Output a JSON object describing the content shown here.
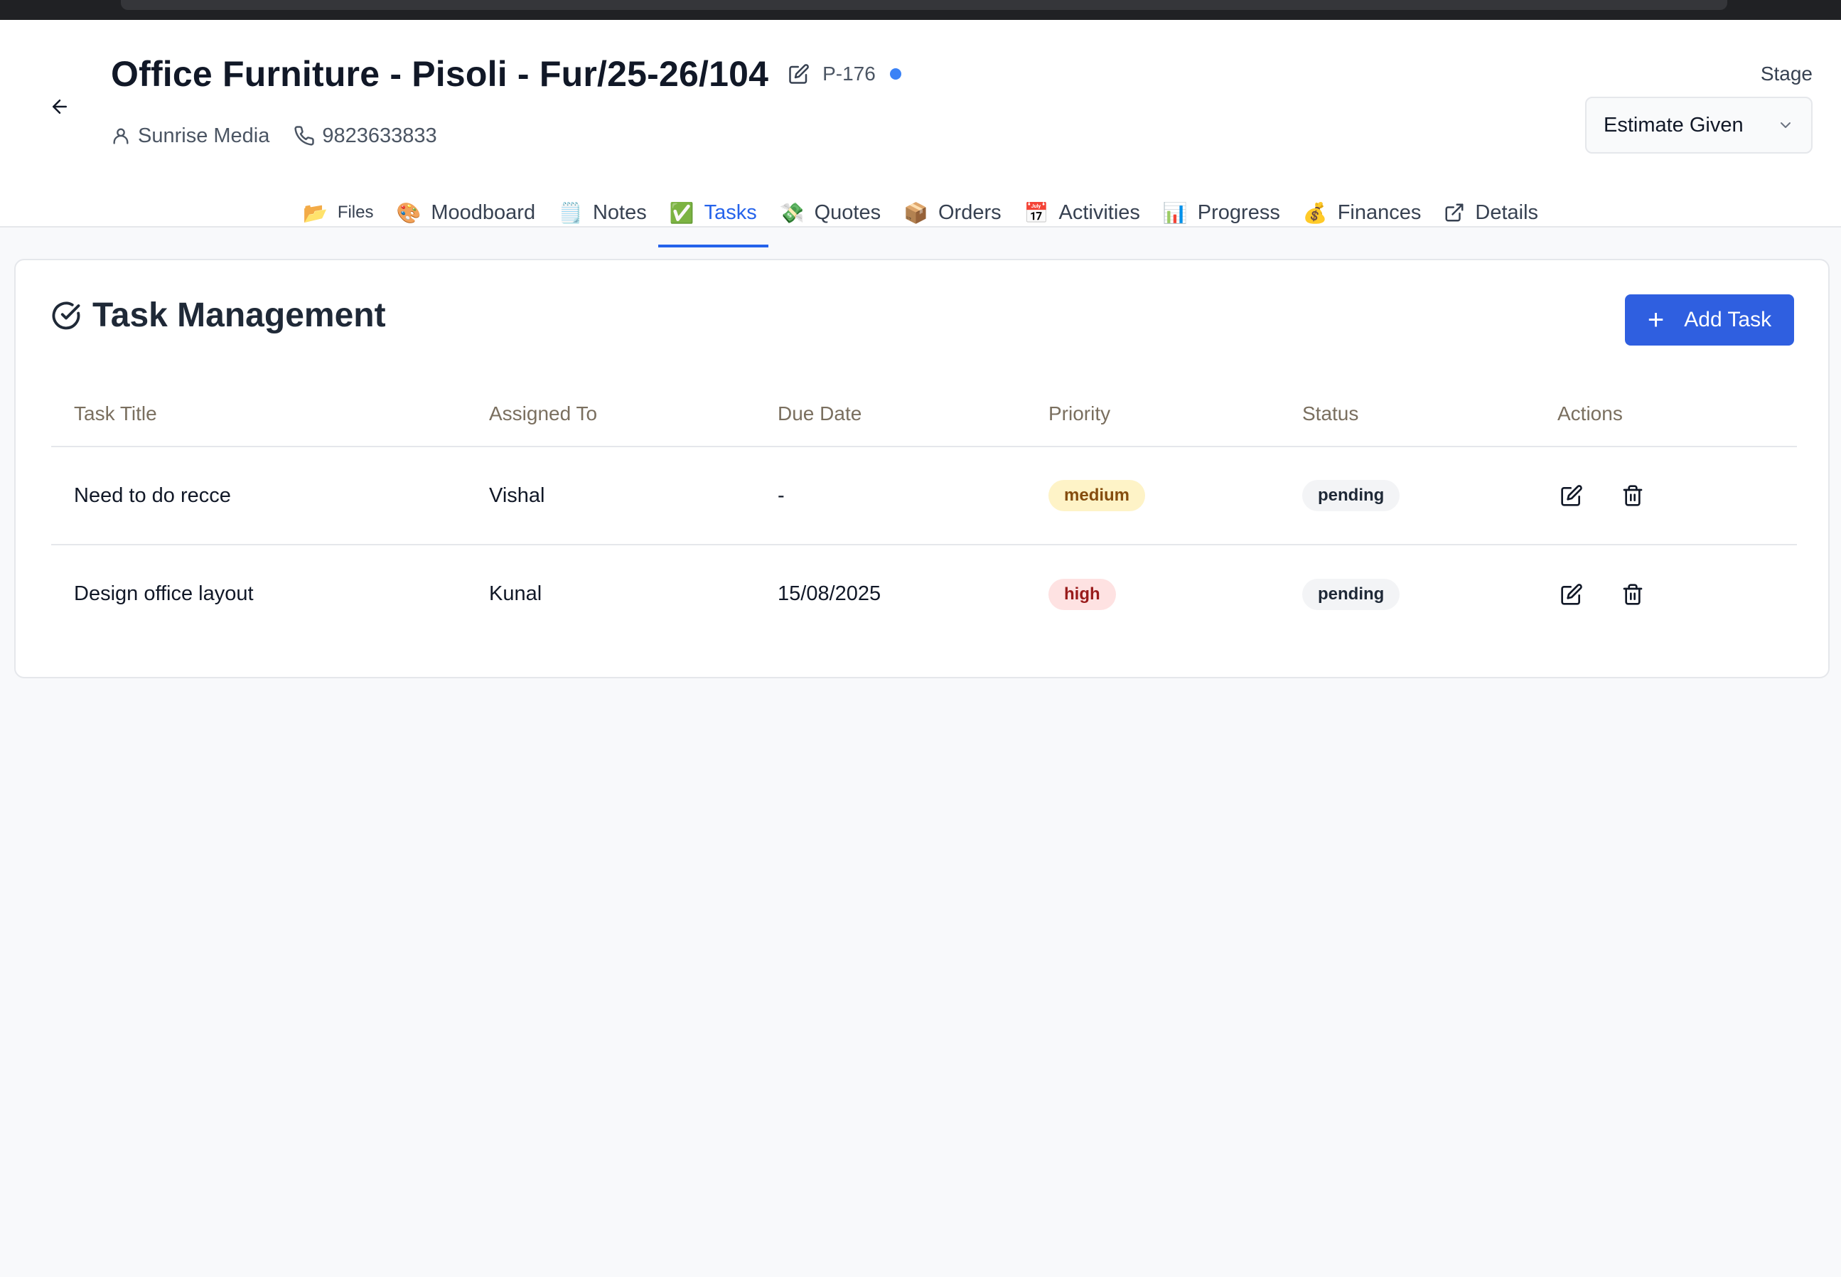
{
  "header": {
    "title": "Office Furniture - Pisoli - Fur/25-26/104",
    "project_code": "P-176",
    "client_name": "Sunrise Media",
    "phone": "9823633833",
    "stage_label": "Stage",
    "stage_value": "Estimate Given"
  },
  "tabs": [
    {
      "label": "Files",
      "emoji": "📂"
    },
    {
      "label": "Moodboard",
      "emoji": "🎨"
    },
    {
      "label": "Notes",
      "emoji": "🗒️"
    },
    {
      "label": "Tasks",
      "emoji": "✅"
    },
    {
      "label": "Quotes",
      "emoji": "💸"
    },
    {
      "label": "Orders",
      "emoji": "📦"
    },
    {
      "label": "Activities",
      "emoji": "📅"
    },
    {
      "label": "Progress",
      "emoji": "📊"
    },
    {
      "label": "Finances",
      "emoji": "💰"
    },
    {
      "label": "Details",
      "emoji": ""
    }
  ],
  "active_tab": "Tasks",
  "tasks": {
    "title": "Task Management",
    "add_button": "Add Task",
    "columns": [
      "Task Title",
      "Assigned To",
      "Due Date",
      "Priority",
      "Status",
      "Actions"
    ],
    "rows": [
      {
        "title": "Need to do recce",
        "assigned": "Vishal",
        "due": "-",
        "priority": "medium",
        "status": "pending"
      },
      {
        "title": "Design office layout",
        "assigned": "Kunal",
        "due": "15/08/2025",
        "priority": "high",
        "status": "pending"
      }
    ]
  },
  "colors": {
    "accent": "#2563eb",
    "button": "#2f5fe0",
    "priority_medium_bg": "#fef3c7",
    "priority_high_bg": "#fee2e2",
    "status_bg": "#f3f4f6"
  }
}
